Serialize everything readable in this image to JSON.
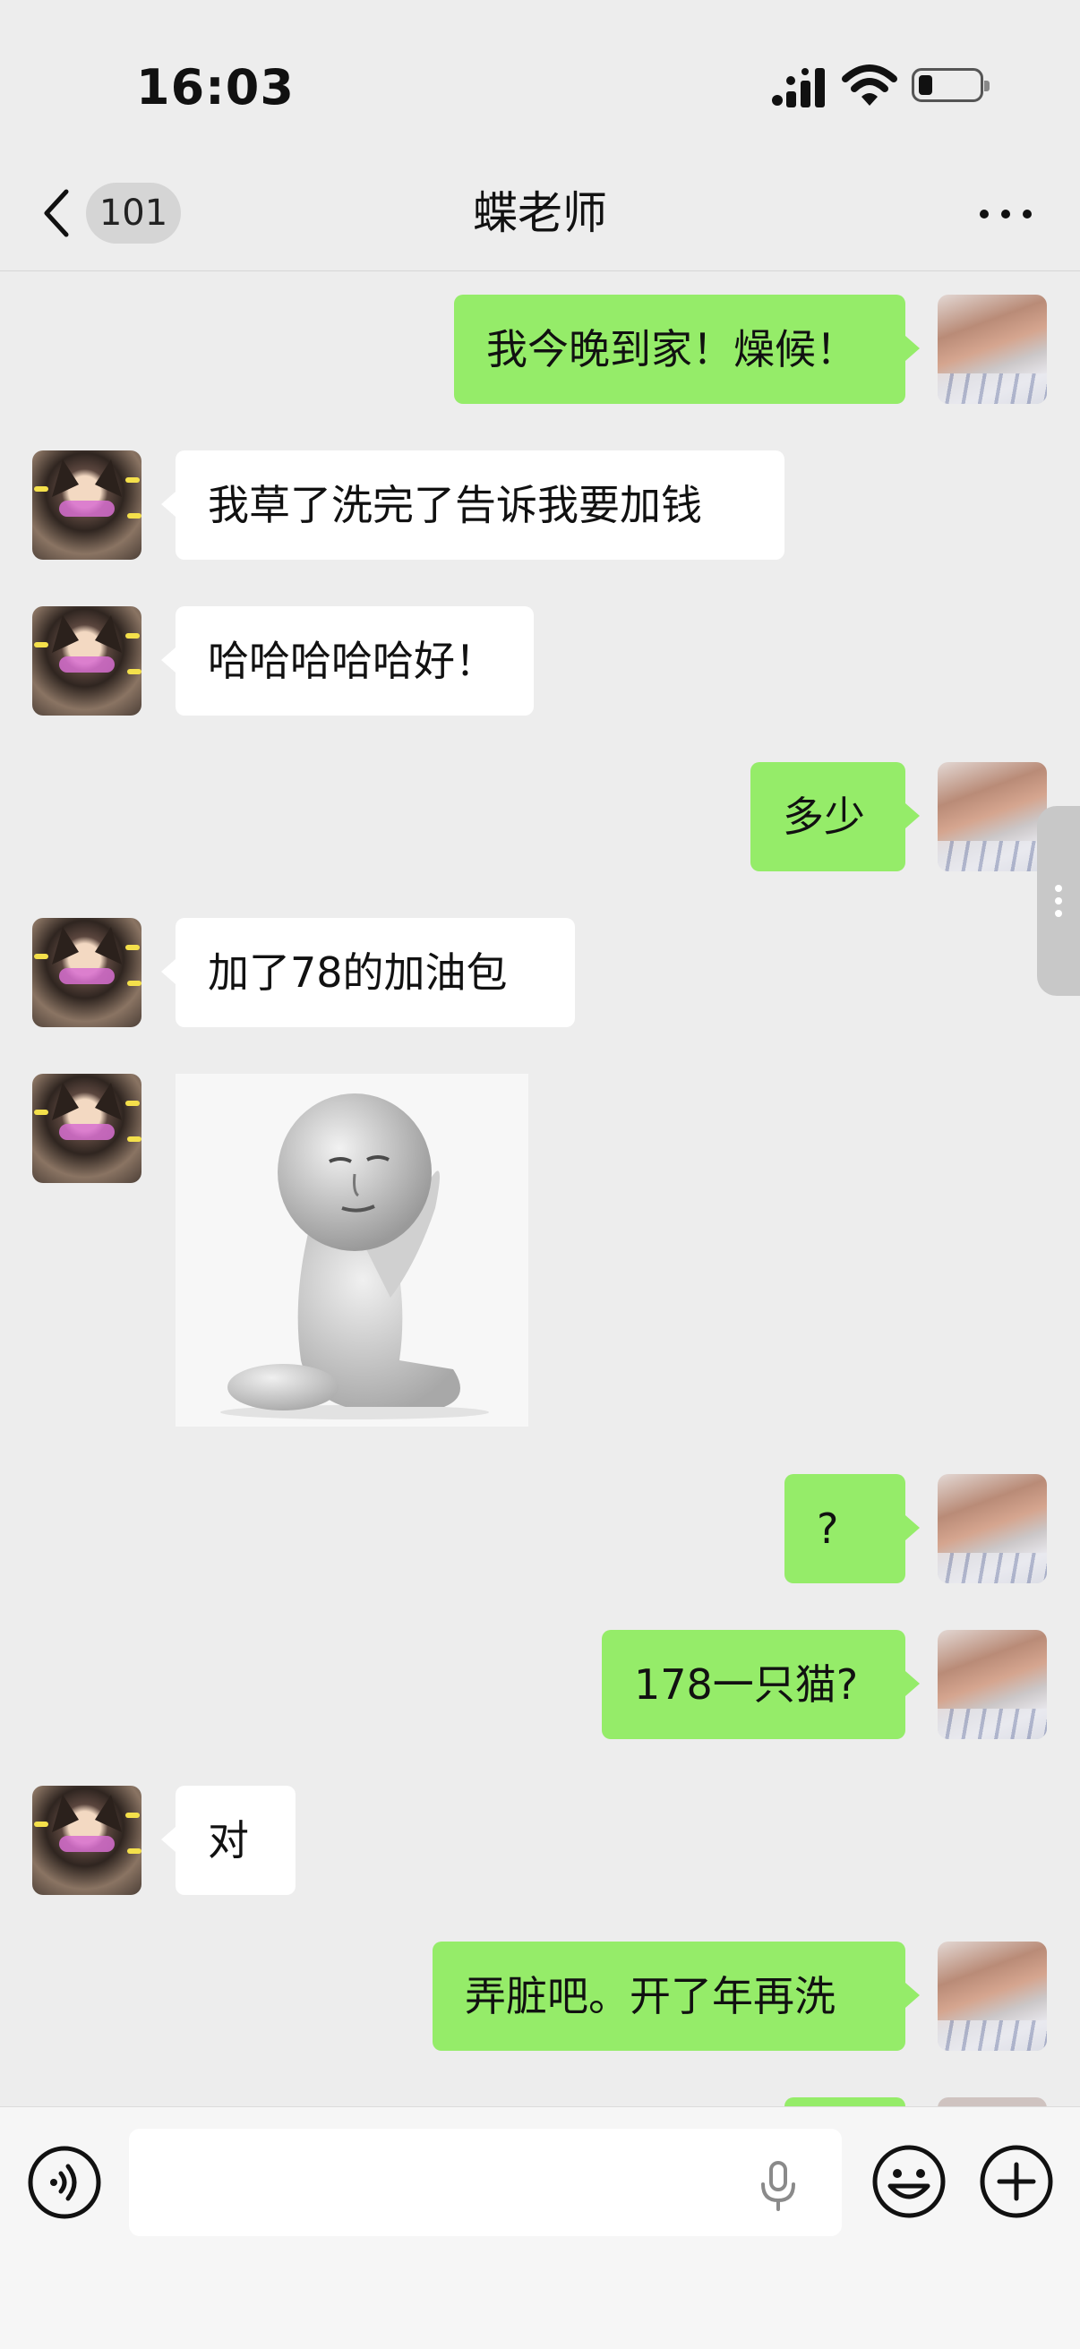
{
  "status_bar": {
    "time": "16:03",
    "icons": [
      "cellular-signal-icon",
      "wifi-icon",
      "battery-low-icon"
    ]
  },
  "header": {
    "back_icon": "chevron-left-icon",
    "unread_count": "101",
    "title": "蝶老师",
    "more_icon": "more-dots-icon"
  },
  "messages": [
    {
      "side": "out",
      "type": "text",
      "text": "我今晚到家！燥候！"
    },
    {
      "side": "in",
      "type": "text",
      "text": "我草了洗完了告诉我要加钱"
    },
    {
      "side": "in",
      "type": "text",
      "text": "哈哈哈哈哈好！"
    },
    {
      "side": "out",
      "type": "text",
      "text": "多少"
    },
    {
      "side": "in",
      "type": "text",
      "text": "加了78的加油包"
    },
    {
      "side": "in",
      "type": "sticker",
      "sticker": "praying-figure-sticker"
    },
    {
      "side": "out",
      "type": "text",
      "text": "?"
    },
    {
      "side": "out",
      "type": "text",
      "text": "178一只猫?"
    },
    {
      "side": "in",
      "type": "text",
      "text": "对"
    },
    {
      "side": "out",
      "type": "text",
      "text": "弄脏吧。开了年再洗"
    }
  ],
  "input_bar": {
    "voice_icon": "voice-mode-icon",
    "mic_icon": "microphone-icon",
    "emoji_icon": "emoji-icon",
    "plus_icon": "plus-icon"
  },
  "colors": {
    "background": "#ededed",
    "outgoing_bubble": "#95ec69",
    "incoming_bubble": "#ffffff"
  }
}
